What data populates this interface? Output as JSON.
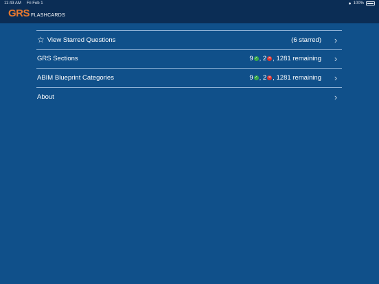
{
  "status_bar": {
    "time": "11:43 AM",
    "date": "Fri Feb 1",
    "battery": "100%"
  },
  "header": {
    "logo_main": "GRS",
    "logo_sub": "FLASHCARDS"
  },
  "menu": {
    "starred": {
      "label": "View Starred Questions",
      "meta": "(6 starred)"
    },
    "sections": {
      "label": "GRS Sections",
      "correct": "9",
      "incorrect": "2",
      "remaining": ", 1281 remaining"
    },
    "abim": {
      "label": "ABIM Blueprint Categories",
      "correct": "9",
      "incorrect": "2",
      "remaining": ", 1281 remaining"
    },
    "about": {
      "label": "About"
    }
  },
  "colors": {
    "background": "#10508a",
    "header": "#0b2d55",
    "logo_accent": "#e8782e",
    "correct": "#3aa84a",
    "incorrect": "#d8322f"
  },
  "icons": [
    "wifi-icon",
    "battery-icon",
    "star-icon",
    "chevron-right-icon",
    "check-icon",
    "x-icon"
  ]
}
